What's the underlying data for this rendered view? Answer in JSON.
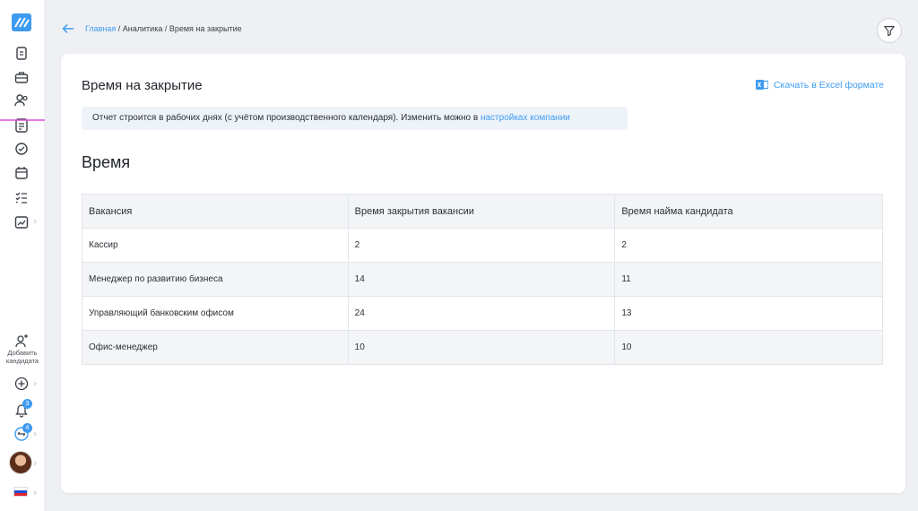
{
  "sidebar": {
    "add_candidate_label": "Добавить кандидата",
    "notifications_count": "3",
    "messages_count": "4"
  },
  "breadcrumb": {
    "home": "Главная",
    "sep": " / ",
    "analytics": "Аналитика",
    "current": "Время на закрытие"
  },
  "page": {
    "title": "Время на закрытие",
    "excel_label": "Скачать в Excel формате",
    "notice_text": "Отчет строится в рабочих днях (с учётом производственного календаря). Изменить можно в ",
    "notice_link": "настройках компании",
    "section_title": "Время"
  },
  "table": {
    "headers": [
      "Вакансия",
      "Время закрытия вакансии",
      "Время найма кандидата"
    ],
    "rows": [
      [
        "Кассир",
        "2",
        "2"
      ],
      [
        "Менеджер по развитию бизнеса",
        "14",
        "11"
      ],
      [
        "Управляющий банковским офисом",
        "24",
        "13"
      ],
      [
        "Офис-менеджер",
        "10",
        "10"
      ]
    ]
  },
  "colors": {
    "accent": "#3e9bf0",
    "annotation_arrow": "#e04ce0",
    "excel_green": "#3e9bf0"
  }
}
